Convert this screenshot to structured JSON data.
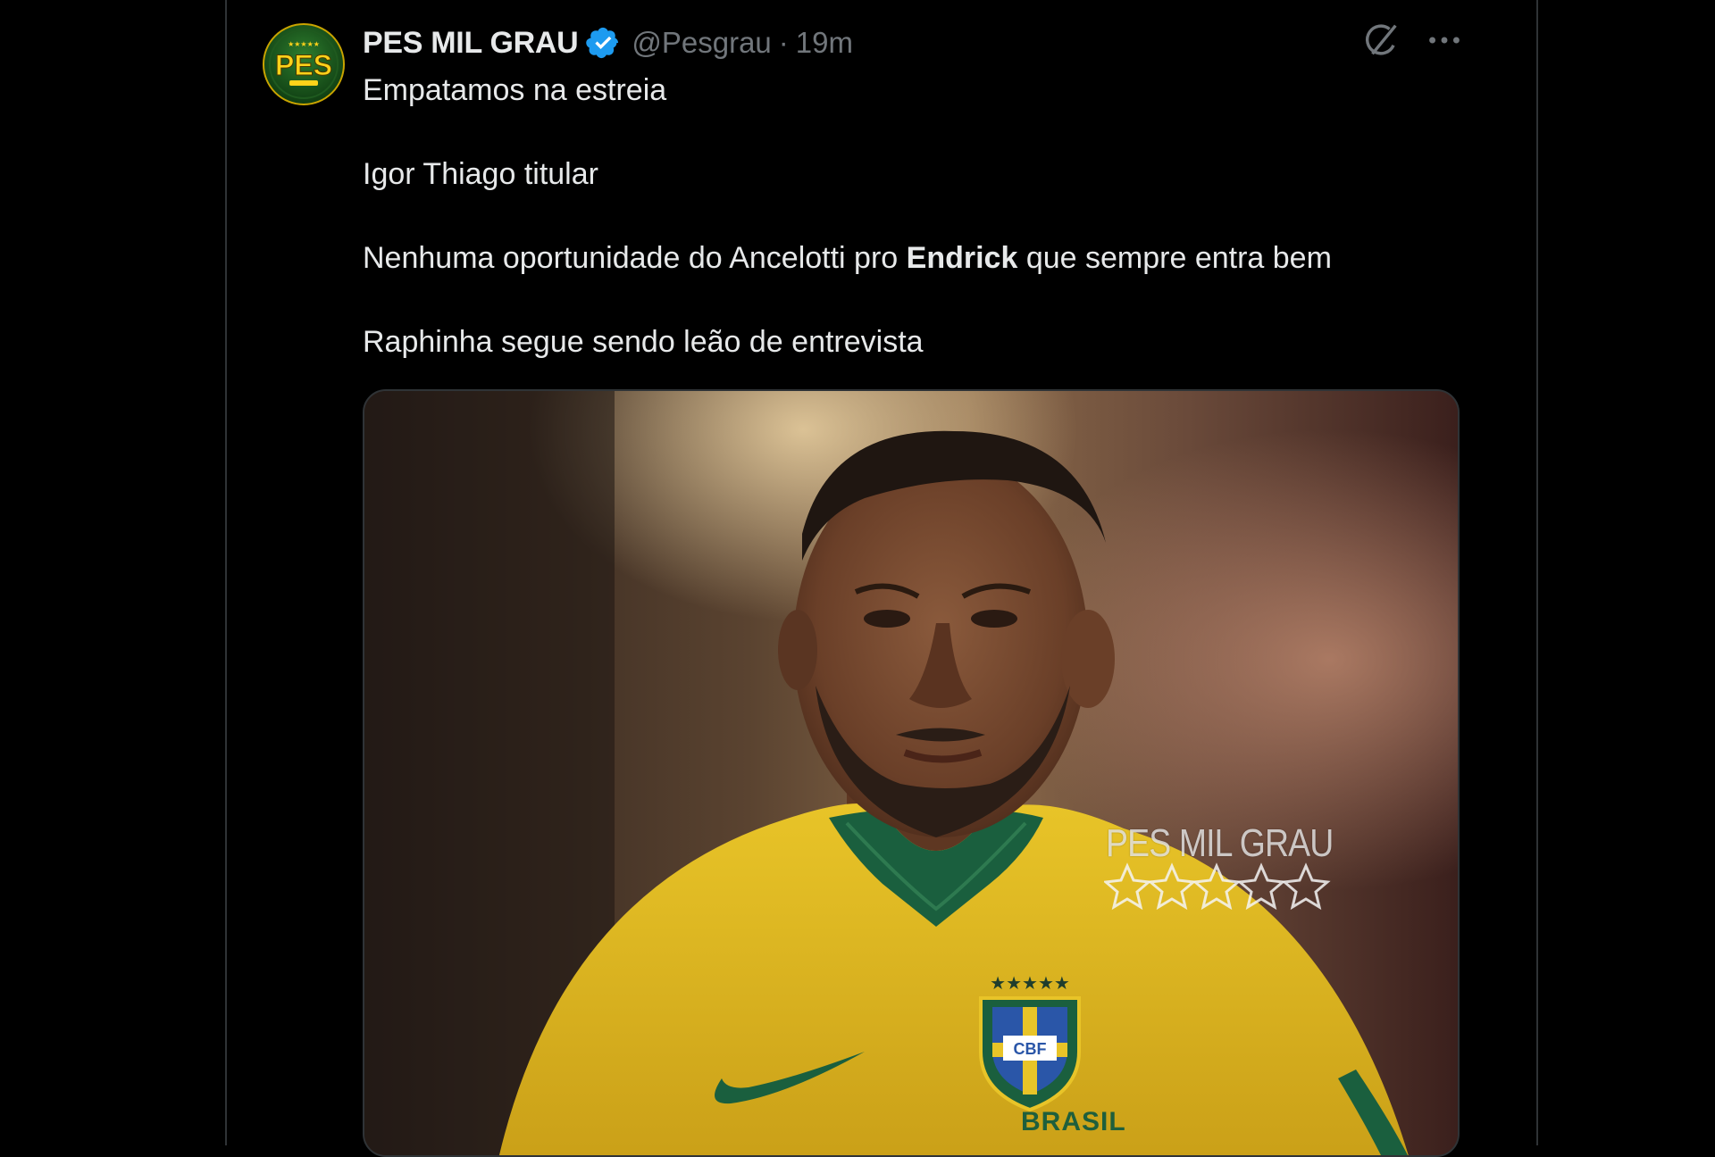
{
  "tweet": {
    "display_name": "PES MIL GRAU",
    "handle": "@Pesgrau",
    "separator": "·",
    "time": "19m",
    "lines": [
      "Empatamos na estreia",
      "Igor Thiago titular",
      "Raphinha segue sendo leão de entrevista"
    ],
    "line3": {
      "before": "Nenhuma oportunidade do Ancelotti pro ",
      "bold": "Endrick",
      "after": " que sempre entra bem"
    },
    "avatar_text": "PES",
    "media": {
      "watermark": "PES MIL GRAU",
      "watermark_stars": 5,
      "shirt_text": "BRASIL",
      "badge_text": "CBF"
    }
  },
  "icons": {
    "verified": "verified-badge-icon",
    "grok": "grok-icon",
    "more": "more-options-icon"
  },
  "colors": {
    "background": "#000000",
    "verified": "#1d9bf0",
    "secondary_text": "#71767b",
    "primary_text": "#e7e9ea"
  }
}
